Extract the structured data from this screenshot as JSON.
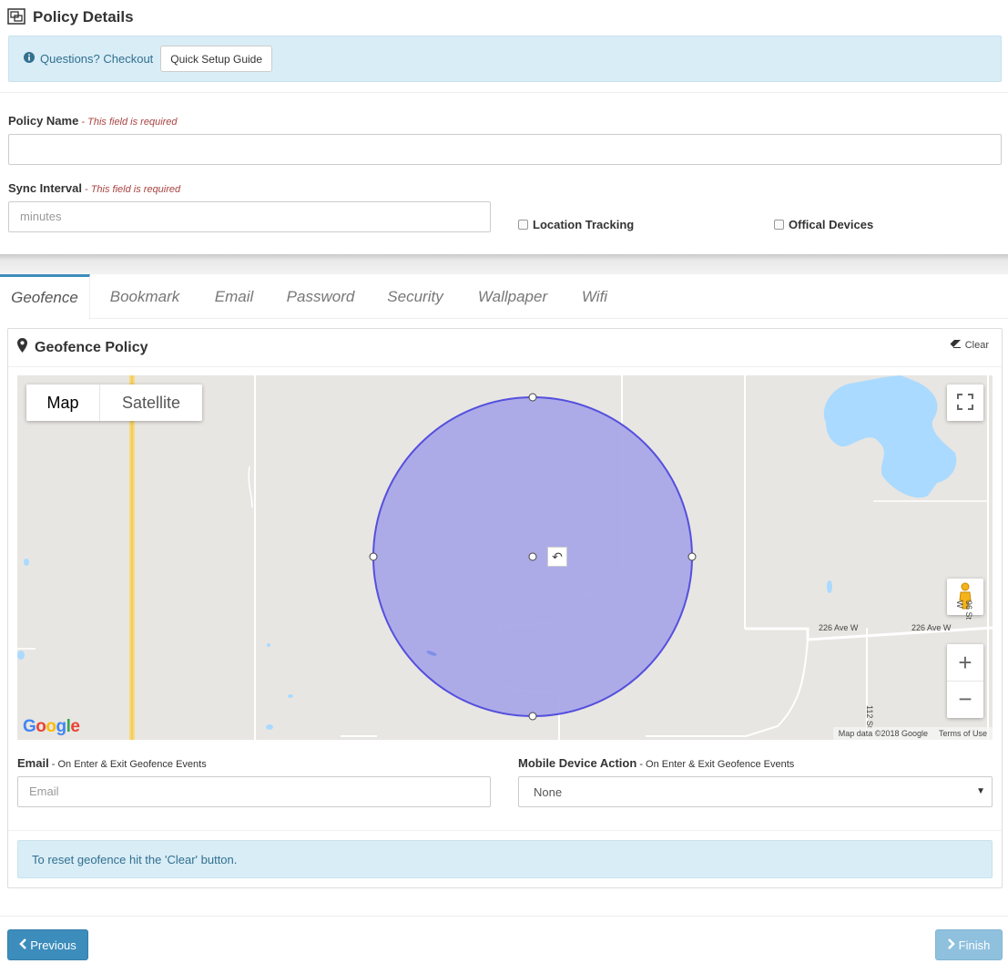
{
  "header": {
    "title": "Policy Details"
  },
  "info": {
    "text": "Questions? Checkout",
    "button": "Quick Setup Guide"
  },
  "form": {
    "policy_name": {
      "label": "Policy Name",
      "required": " - This field is required",
      "value": ""
    },
    "sync_interval": {
      "label": "Sync Interval",
      "required": " - This field is required",
      "placeholder": "minutes"
    },
    "location_tracking": {
      "label": "Location Tracking",
      "checked": false
    },
    "official_devices": {
      "label": "Offical Devices",
      "checked": false
    }
  },
  "tabs": [
    {
      "label": "Geofence",
      "active": true
    },
    {
      "label": "Bookmark"
    },
    {
      "label": "Email"
    },
    {
      "label": "Password"
    },
    {
      "label": "Security"
    },
    {
      "label": "Wallpaper"
    },
    {
      "label": "Wifi"
    }
  ],
  "panel": {
    "title": "Geofence Policy",
    "clear": "Clear",
    "map": {
      "map_type": [
        "Map",
        "Satellite"
      ],
      "selected_type": "Map",
      "road_labels": [
        "226 Ave W",
        "226 Ave W",
        "96 St W",
        "112 St"
      ],
      "attribution": "Map data ©2018 Google",
      "terms": "Terms of Use",
      "logo": "Google",
      "circle_color": "#a9a8e8",
      "circle_stroke": "#5550dd"
    },
    "email": {
      "label": "Email",
      "sub": " - On Enter & Exit Geofence Events",
      "placeholder": "Email"
    },
    "mobile_action": {
      "label": "Mobile Device Action",
      "sub": " - On Enter & Exit Geofence Events",
      "value": "None"
    },
    "help": "To reset geofence hit the 'Clear' button."
  },
  "footer": {
    "previous": "Previous",
    "finish": "Finish"
  },
  "colors": {
    "primary": "#3c8dbc",
    "info_bg": "#d9edf7",
    "info_text": "#31708f",
    "required": "#a94442"
  }
}
